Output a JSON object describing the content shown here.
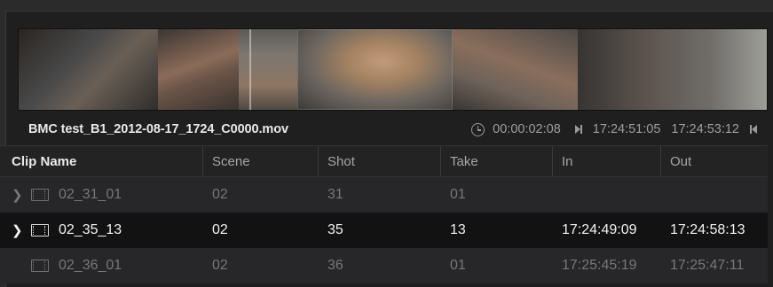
{
  "clip": {
    "name": "BMC test_B1_2012-08-17_1724_C0000.mov",
    "duration": "00:00:02:08",
    "tc_in": "17:24:51:05",
    "tc_out": "17:24:53:12"
  },
  "icons": {
    "duration": "clock-icon",
    "in_marker": "play-in-icon",
    "out_marker": "play-out-icon",
    "row_expand": "chevron-right-icon",
    "clip": "film-clip-icon"
  },
  "table": {
    "headers": [
      "Clip Name",
      "Scene",
      "Shot",
      "Take",
      "In",
      "Out"
    ],
    "rows": [
      {
        "name": "02_31_01",
        "scene": "02",
        "shot": "31",
        "take": "01",
        "in": "",
        "out": "",
        "expandable": true,
        "selected": false
      },
      {
        "name": "02_35_13",
        "scene": "02",
        "shot": "35",
        "take": "13",
        "in": "17:24:49:09",
        "out": "17:24:58:13",
        "expandable": true,
        "selected": true
      },
      {
        "name": "02_36_01",
        "scene": "02",
        "shot": "36",
        "take": "01",
        "in": "17:25:45:19",
        "out": "17:25:47:11",
        "expandable": false,
        "selected": false
      }
    ]
  },
  "colors": {
    "background": "#2b2b2c",
    "panel": "#1f1f20",
    "selected_row": "#121213",
    "text_selected": "#f2f2f2",
    "text_dim": "#777777"
  }
}
